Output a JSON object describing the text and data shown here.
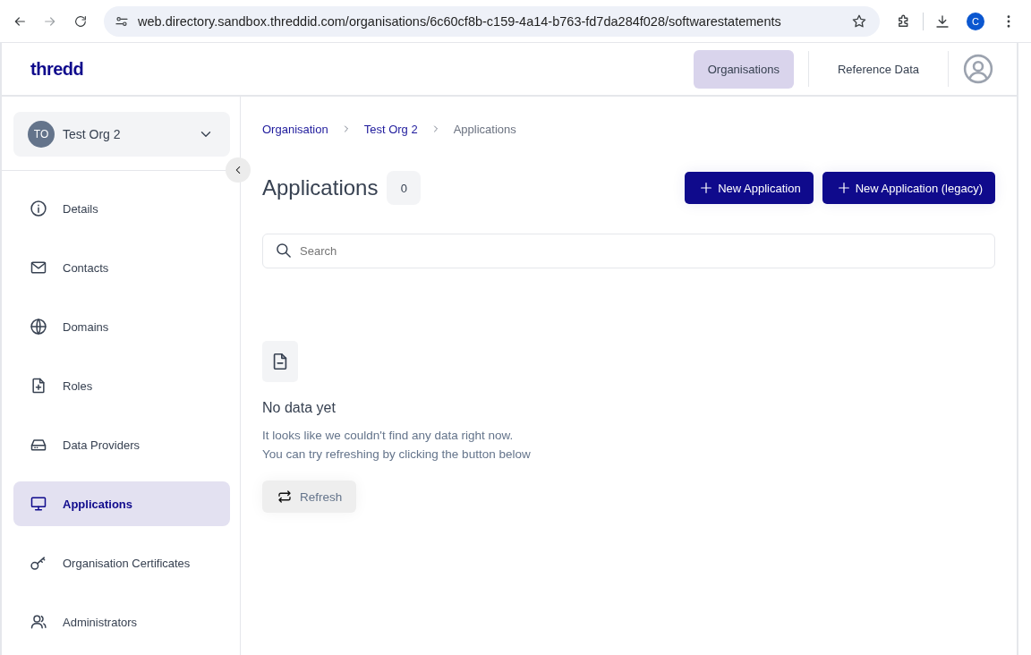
{
  "browser": {
    "url": "web.directory.sandbox.threddid.com/organisations/6c60cf8b-c159-4a14-b763-fd7da284f028/softwarestatements",
    "profile_initial": "C"
  },
  "header": {
    "logo": "thredd",
    "nav": [
      {
        "label": "Organisations",
        "selected": true
      },
      {
        "label": "Reference Data",
        "selected": false
      }
    ]
  },
  "org_selector": {
    "initials": "TO",
    "name": "Test Org 2"
  },
  "sidebar": {
    "items": [
      {
        "kind": "info",
        "label": "Details",
        "selected": false
      },
      {
        "kind": "mail",
        "label": "Contacts",
        "selected": false
      },
      {
        "kind": "globe",
        "label": "Domains",
        "selected": false
      },
      {
        "kind": "file-plus",
        "label": "Roles",
        "selected": false
      },
      {
        "kind": "drive",
        "label": "Data Providers",
        "selected": false
      },
      {
        "kind": "monitor",
        "label": "Applications",
        "selected": true
      },
      {
        "kind": "key",
        "label": "Organisation Certificates",
        "selected": false
      },
      {
        "kind": "users",
        "label": "Administrators",
        "selected": false
      }
    ]
  },
  "breadcrumb": [
    {
      "label": "Organisation",
      "link": true
    },
    {
      "label": "Test Org 2",
      "link": true
    },
    {
      "label": "Applications",
      "link": false
    }
  ],
  "page": {
    "title": "Applications",
    "count": "0",
    "buttons": [
      "New Application",
      "New Application (legacy)"
    ]
  },
  "search": {
    "placeholder": "Search"
  },
  "empty_state": {
    "title": "No data yet",
    "lines": [
      "It looks like we couldn't find any data right now.",
      "You can try refreshing by clicking the button below"
    ],
    "button": "Refresh"
  }
}
